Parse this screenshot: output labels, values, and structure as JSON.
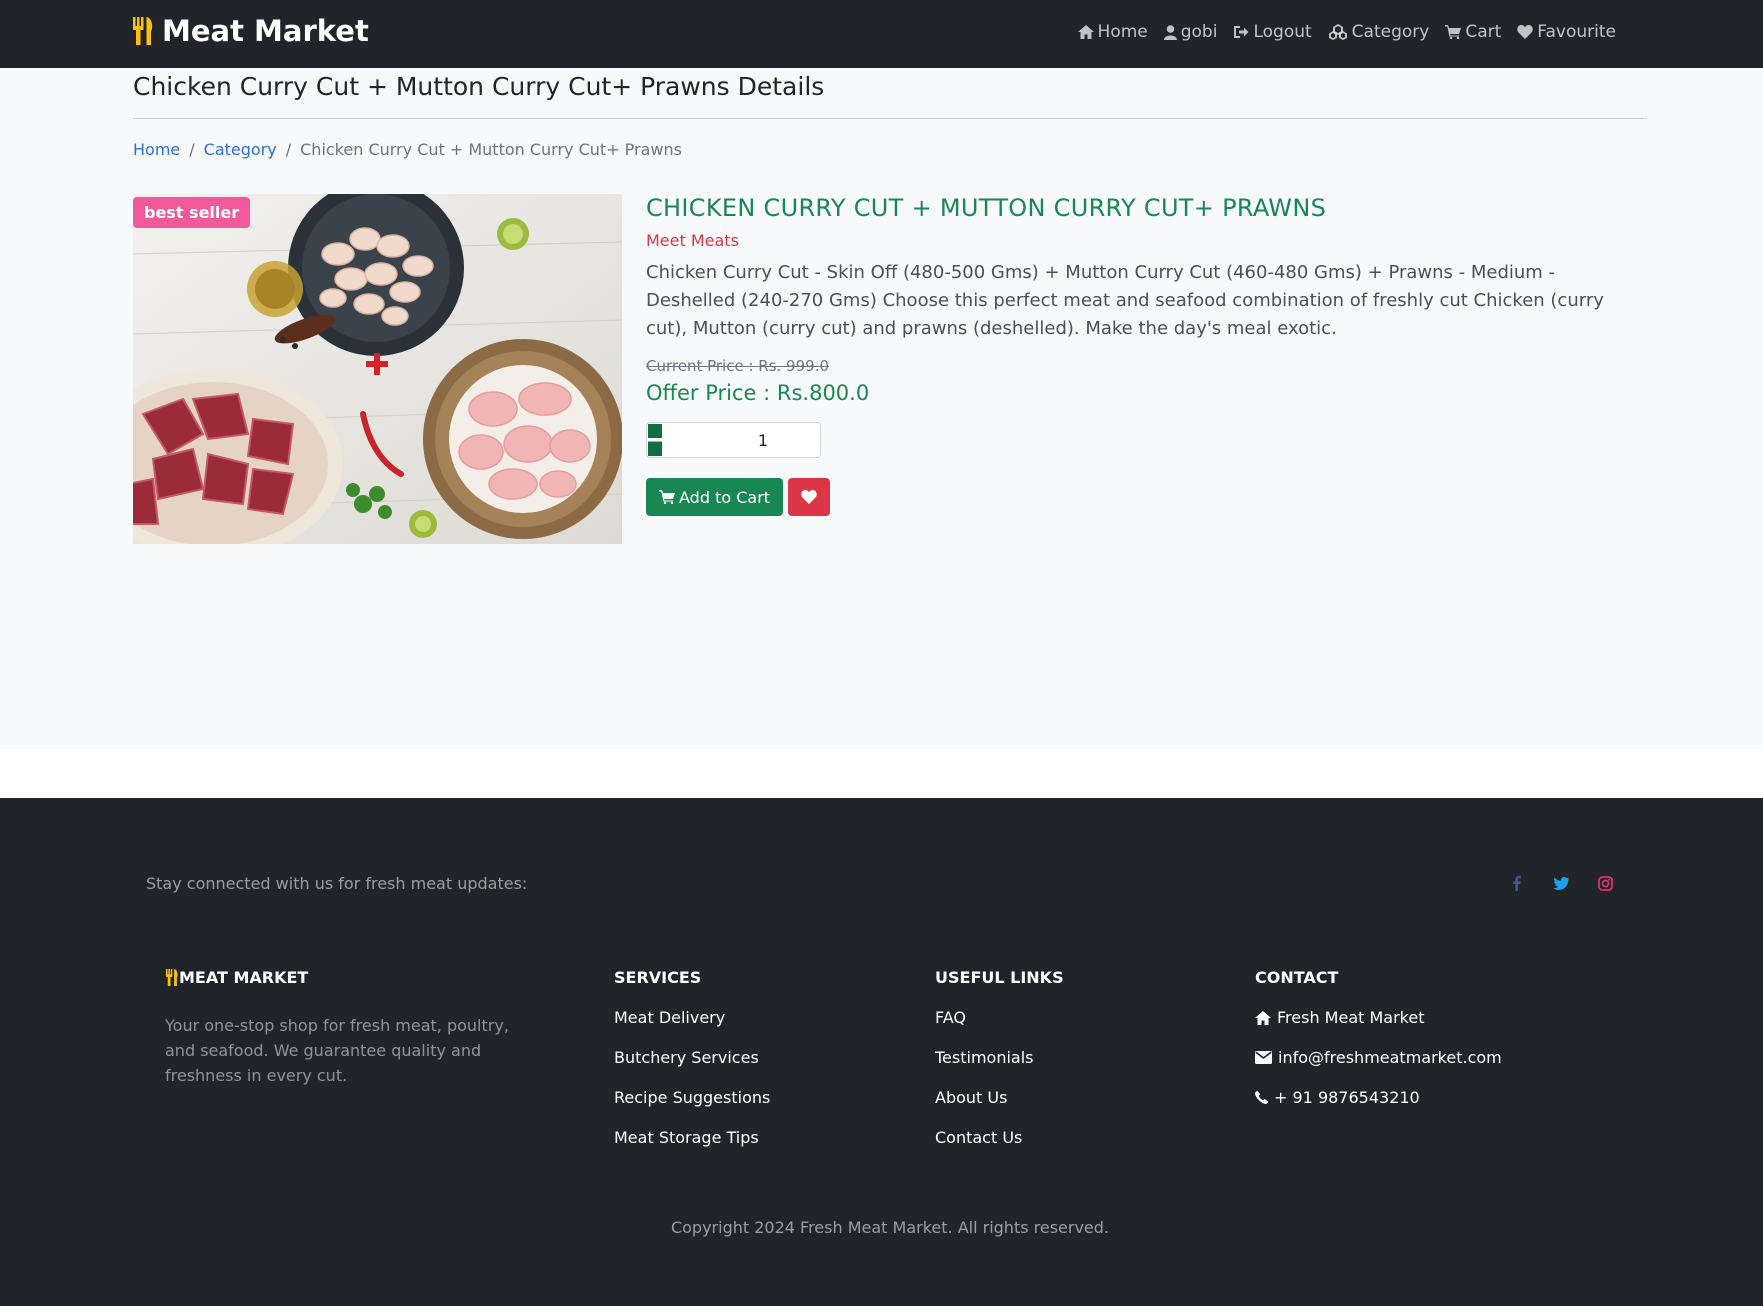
{
  "navbar": {
    "brand": "Meat Market",
    "links": [
      {
        "icon": "home-icon",
        "label": "Home"
      },
      {
        "icon": "user-icon",
        "label": "gobi"
      },
      {
        "icon": "logout-icon",
        "label": "Logout"
      },
      {
        "icon": "category-icon",
        "label": "Category"
      },
      {
        "icon": "cart-icon",
        "label": "Cart"
      },
      {
        "icon": "heart-icon",
        "label": "Favourite"
      }
    ]
  },
  "page": {
    "title": "Chicken Curry Cut + Mutton Curry Cut+ Prawns Details"
  },
  "breadcrumb": {
    "home": "Home",
    "category": "Category",
    "current": "Chicken Curry Cut + Mutton Curry Cut+ Prawns"
  },
  "product": {
    "badge": "best seller",
    "name": "CHICKEN CURRY CUT + MUTTON CURRY CUT+ PRAWNS",
    "brand": "Meet Meats",
    "description": "Chicken Curry Cut - Skin Off (480-500 Gms) + Mutton Curry Cut (460-480 Gms) + Prawns - Medium - Deshelled (240-270 Gms) Choose this perfect meat and seafood combination of freshly cut Chicken (curry cut), Mutton (curry cut) and prawns (deshelled). Make the day's meal exotic.",
    "current_price": "Current Price : Rs. 999.0",
    "offer_price": "Offer Price : Rs.800.0",
    "quantity": "1",
    "add_to_cart": "Add to Cart"
  },
  "footer": {
    "stay_connected": "Stay connected with us for fresh meat updates:",
    "social": [
      {
        "icon": "facebook-icon",
        "color": "#3b5998"
      },
      {
        "icon": "twitter-icon",
        "color": "#1da1f2"
      },
      {
        "icon": "instagram-icon",
        "color": "#e1306c"
      }
    ],
    "about": {
      "heading": "MEAT MARKET",
      "text": "Your one-stop shop for fresh meat, poultry, and seafood. We guarantee quality and freshness in every cut."
    },
    "services": {
      "heading": "SERVICES",
      "items": [
        "Meat Delivery",
        "Butchery Services",
        "Recipe Suggestions",
        "Meat Storage Tips"
      ]
    },
    "useful_links": {
      "heading": "USEFUL LINKS",
      "items": [
        "FAQ",
        "Testimonials",
        "About Us",
        "Contact Us"
      ]
    },
    "contact": {
      "heading": "CONTACT",
      "items": [
        "Fresh Meat Market",
        "info@freshmeatmarket.com",
        "+ 91 9876543210"
      ]
    },
    "copyright": "Copyright 2024 Fresh Meat Market. All rights reserved."
  },
  "colors": {
    "navbar": "#212529",
    "accent_green": "#198754",
    "danger": "#dc3545",
    "badge": "#f05a9a",
    "brand_icon": "#ffc107"
  }
}
